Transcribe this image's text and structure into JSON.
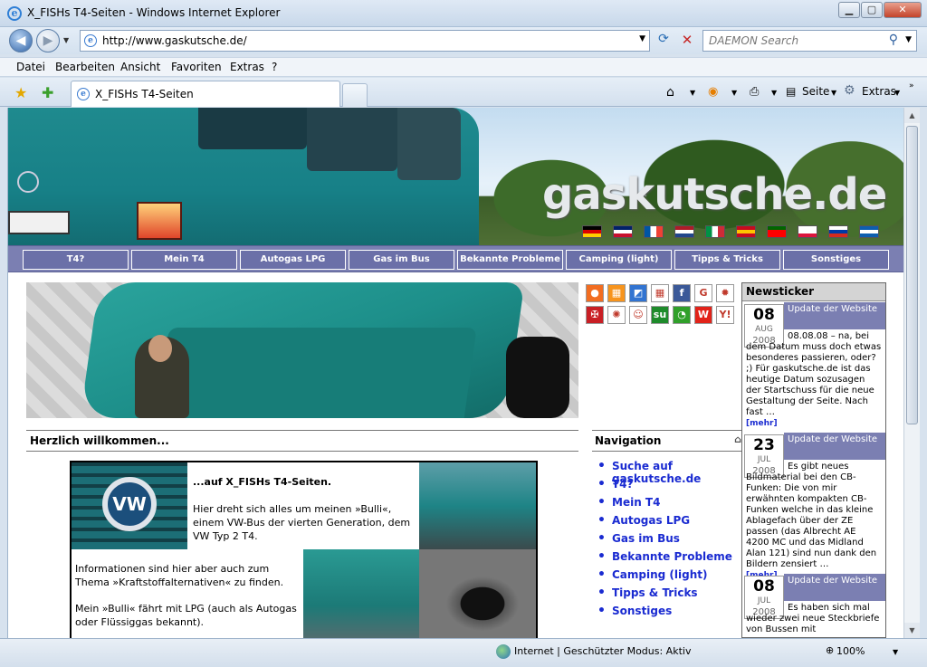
{
  "window": {
    "title": "X_FISHs T4-Seiten - Windows Internet Explorer",
    "minimize": "▁",
    "maximize": "▢",
    "close": "✕"
  },
  "address": {
    "url": "http://www.gaskutsche.de/",
    "search_placeholder": "DAEMON Search"
  },
  "menu": [
    "Datei",
    "Bearbeiten",
    "Ansicht",
    "Favoriten",
    "Extras",
    "?"
  ],
  "tab": {
    "title": "X_FISHs T4-Seiten"
  },
  "tools": {
    "page": "Seite",
    "extras": "Extras"
  },
  "banner": {
    "brand": "gaskutsche.de"
  },
  "flags": [
    {
      "name": "de",
      "colors": [
        "#000000",
        "#dd0000",
        "#ffce00"
      ]
    },
    {
      "name": "gb",
      "colors": [
        "#012169",
        "#ffffff",
        "#c8102e"
      ]
    },
    {
      "name": "fr",
      "colors": [
        "#0055a4",
        "#ffffff",
        "#ef4135"
      ]
    },
    {
      "name": "nl",
      "colors": [
        "#ae1c28",
        "#ffffff",
        "#21468b"
      ]
    },
    {
      "name": "it",
      "colors": [
        "#009246",
        "#ffffff",
        "#ce2b37"
      ]
    },
    {
      "name": "es",
      "colors": [
        "#c60b1e",
        "#ffc400",
        "#c60b1e"
      ]
    },
    {
      "name": "pt",
      "colors": [
        "#006600",
        "#ff0000",
        "#ff0000"
      ]
    },
    {
      "name": "pl",
      "colors": [
        "#ffffff",
        "#ffffff",
        "#dc143c"
      ]
    },
    {
      "name": "ru",
      "colors": [
        "#ffffff",
        "#0039a6",
        "#d52b1e"
      ]
    },
    {
      "name": "gr",
      "colors": [
        "#0d5eaf",
        "#ffffff",
        "#0d5eaf"
      ]
    }
  ],
  "topnav": [
    "T4?",
    "Mein T4",
    "Autogas LPG",
    "Gas im Bus",
    "Bekannte Probleme",
    "Camping (light)",
    "Tipps & Tricks",
    "Sonstiges"
  ],
  "share_icons": [
    {
      "name": "blinklist",
      "color": "#f26d21",
      "glyph": "●"
    },
    {
      "name": "bloglines",
      "color": "#f7941d",
      "glyph": "▦"
    },
    {
      "name": "delicious",
      "color": "#3274d1",
      "glyph": "◩"
    },
    {
      "name": "digg",
      "color": "#ffffff",
      "glyph": "▦"
    },
    {
      "name": "facebook",
      "color": "#3b5998",
      "glyph": "f"
    },
    {
      "name": "google",
      "color": "#ffffff",
      "glyph": "G"
    },
    {
      "name": "sun",
      "color": "#ffffff",
      "glyph": "✹"
    },
    {
      "name": "mister-wong",
      "color": "#c91f25",
      "glyph": "✠"
    },
    {
      "name": "splash",
      "color": "#ffffff",
      "glyph": "✺"
    },
    {
      "name": "reddit",
      "color": "#ffffff",
      "glyph": "☺"
    },
    {
      "name": "stumbleupon",
      "color": "#1e8b2b",
      "glyph": "su"
    },
    {
      "name": "technorati",
      "color": "#30a02a",
      "glyph": "◔"
    },
    {
      "name": "webnews",
      "color": "#e2231a",
      "glyph": "W"
    },
    {
      "name": "yahoo",
      "color": "#ffffff",
      "glyph": "Y!"
    }
  ],
  "main": {
    "welcome": "Herzlich willkommen...",
    "intro_heading": "...auf X_FISHs T4-Seiten.",
    "intro_p1": "Hier dreht sich alles um meinen »Bulli«, einem VW-Bus der vierten Generation, dem VW Typ 2 T4.",
    "intro_p2": "Informationen sind hier aber auch zum Thema »Kraftstoffalternativen« zu finden.",
    "intro_p3": "Mein »Bulli« fährt mit LPG (auch als Autogas oder Flüssiggas bekannt)."
  },
  "navigation": {
    "title": "Navigation",
    "items": [
      "Suche auf gaskutsche.de",
      "T4?",
      "Mein T4",
      "Autogas LPG",
      "Gas im Bus",
      "Bekannte Probleme",
      "Camping (light)",
      "Tipps & Tricks",
      "Sonstiges"
    ]
  },
  "newsticker": {
    "title": "Newsticker",
    "more": "[mehr]",
    "entries": [
      {
        "day": "08",
        "month": "AUG",
        "year": "2008",
        "title": "Update der Website",
        "text": "08.08.08 – na, bei dem Datum muss doch etwas besonderes passieren, oder? ;) Für gaskutsche.de ist das heutige Datum sozusagen der Startschuss für die neue Gestaltung der Seite. Nach fast …"
      },
      {
        "day": "23",
        "month": "JUL",
        "year": "2008",
        "title": "Update der Website",
        "text": "Es gibt neues Bildmaterial bei den CB-Funken: Die von mir erwähnten kompakten CB-Funken welche in das kleine Ablagefach über der ZE passen (das Albrecht AE 4200 MC und das Midland Alan 121) sind nun dank den Bildern zensiert …"
      },
      {
        "day": "08",
        "month": "JUL",
        "year": "2008",
        "title": "Update der Website",
        "text": "Es haben sich mal wieder zwei neue Steckbriefe von Bussen mit"
      }
    ]
  },
  "status": {
    "zone": "Internet | Geschützter Modus: Aktiv",
    "zoom": "100%"
  }
}
